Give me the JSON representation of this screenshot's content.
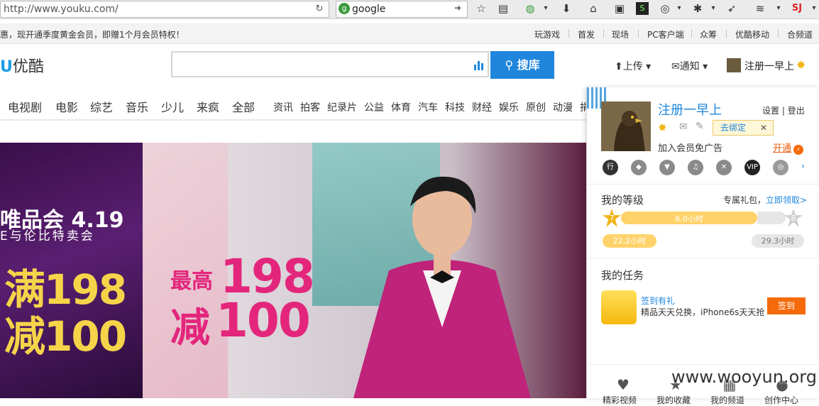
{
  "browser": {
    "url": "http://www.youku.com/",
    "search_engine": "google"
  },
  "site_top": {
    "promo": "惠，现开通季度黄金会员，即赠1个月会员特权！",
    "nav": [
      "玩游戏",
      "首发",
      "现场",
      "PC客户端",
      "众筹",
      "优酷移动",
      "合频道"
    ]
  },
  "header": {
    "logo_u": "U",
    "logo_text": "优酷",
    "search_button": "搜库",
    "upload": "上传",
    "notify": "通知",
    "username": "注册一早上"
  },
  "channels_main": [
    "电视剧",
    "电影",
    "综艺",
    "音乐",
    "少儿",
    "来疯",
    "全部"
  ],
  "channels_sub": [
    "资讯",
    "拍客",
    "纪录片",
    "公益",
    "体育",
    "汽车",
    "科技",
    "财经",
    "娱乐",
    "原创",
    "动漫",
    "捐"
  ],
  "banner": {
    "left_title": "唯品会 4.19",
    "left_sub": "E与伦比特卖会",
    "left_man": "满198",
    "left_jian": "减100",
    "mid_zuigao": "最高",
    "mid_198": "198",
    "mid_jian": "减",
    "mid_100": "100"
  },
  "panel": {
    "username": "注册一早上",
    "settings": "设置",
    "logout": "登出",
    "bind": "去绑定",
    "vip_text": "加入会员免广告",
    "vip_open": "开通",
    "level_title": "我的等级",
    "gift_label": "专属礼包，",
    "gift_link": "立即领取>",
    "level_current": "7",
    "level_next": "8",
    "level_progress_text": "6.0小时",
    "level_progress": 0.7,
    "hours_done": "22.2小时",
    "hours_need": "29.3小时",
    "task_title": "我的任务",
    "task_name": "签到有礼",
    "task_desc": "精品天天兑换，iPhone6s天天抢",
    "task_button": "签到",
    "bottom_labels": [
      "精彩视频",
      "我的收藏",
      "我的频道",
      "创作中心"
    ]
  },
  "watermark": "www.wooyun.org"
}
